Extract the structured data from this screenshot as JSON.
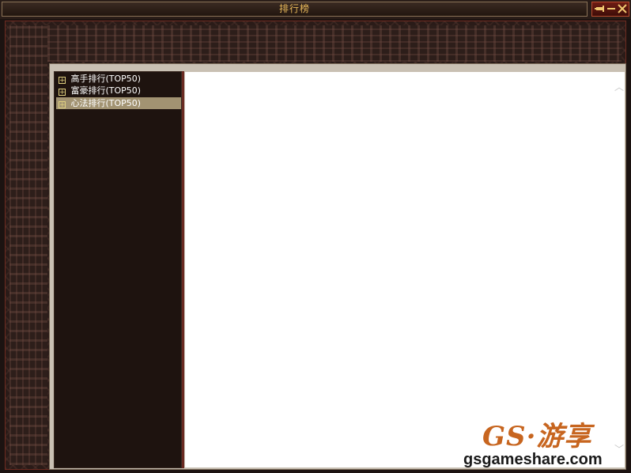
{
  "window": {
    "title": "排行榜",
    "controls": {
      "pin_icon": "pin-icon",
      "minimize_icon": "minimize-icon",
      "close_icon": "close-icon"
    }
  },
  "tree": {
    "items": [
      {
        "label": "高手排行(TOP50)",
        "expander": "+",
        "selected": false
      },
      {
        "label": "富豪排行(TOP50)",
        "expander": "+",
        "selected": false
      },
      {
        "label": "心法排行(TOP50)",
        "expander": "+",
        "selected": true
      }
    ]
  },
  "scrollbar": {
    "up_glyph": "︿",
    "down_glyph": "﹀"
  },
  "watermark": {
    "logo": "GS·游享",
    "url": "gsgameshare.com"
  },
  "colors": {
    "title_text": "#e7b85a",
    "selected_row": "#a29372",
    "panel_bg": "#1e130f",
    "watermark_accent": "#c7651f"
  }
}
